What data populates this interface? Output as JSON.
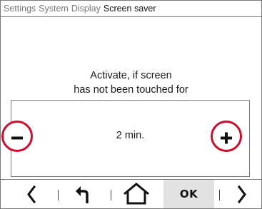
{
  "breadcrumb": {
    "items": [
      "Settings",
      "System",
      "Display"
    ],
    "current": "Screen saver"
  },
  "prompt": {
    "line1": "Activate, if screen",
    "line2": "has not been touched for"
  },
  "value": {
    "display": "2 min."
  },
  "stepper": {
    "decrement_icon": "minus-icon",
    "increment_icon": "plus-icon"
  },
  "toolbar": {
    "back_icon": "chevron-left-icon",
    "undo_icon": "return-arrow-icon",
    "home_icon": "home-icon",
    "ok_label": "OK",
    "forward_icon": "chevron-right-icon"
  },
  "colors": {
    "highlight_ring": "#c8102e",
    "ok_background": "#e2e2e2",
    "text": "#1a1a1a",
    "breadcrumb_inactive": "#777777"
  }
}
